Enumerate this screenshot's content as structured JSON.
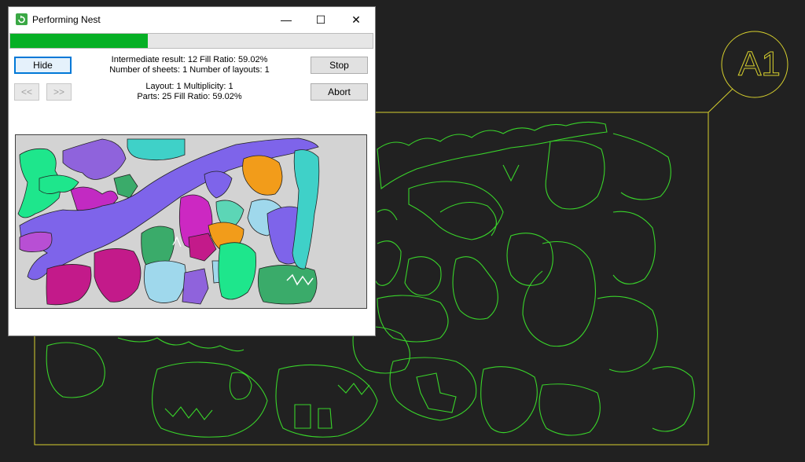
{
  "dialog": {
    "title": "Performing Nest",
    "progress_percent": 38,
    "hide_label": "Hide",
    "stop_label": "Stop",
    "abort_label": "Abort",
    "prev_label": "<<",
    "next_label": ">>",
    "intermediate_line": "Intermediate result: 12  Fill Ratio: 59.02%",
    "sheets_line": "Number of sheets: 1  Number of layouts: 1",
    "layout_line": "Layout: 1  Multiplicity: 1",
    "parts_line": "Parts: 25  Fill Ratio: 59.02%",
    "minimize_glyph": "—",
    "maximize_glyph": "☐",
    "close_glyph": "✕"
  },
  "sheet_badge": {
    "label": "A1"
  },
  "colors": {
    "cad_background": "#212121",
    "sheet_border": "#d6cf2e",
    "cad_parts": "#39d42a",
    "progress": "#06b025",
    "preview_background": "#d3d3d3"
  }
}
